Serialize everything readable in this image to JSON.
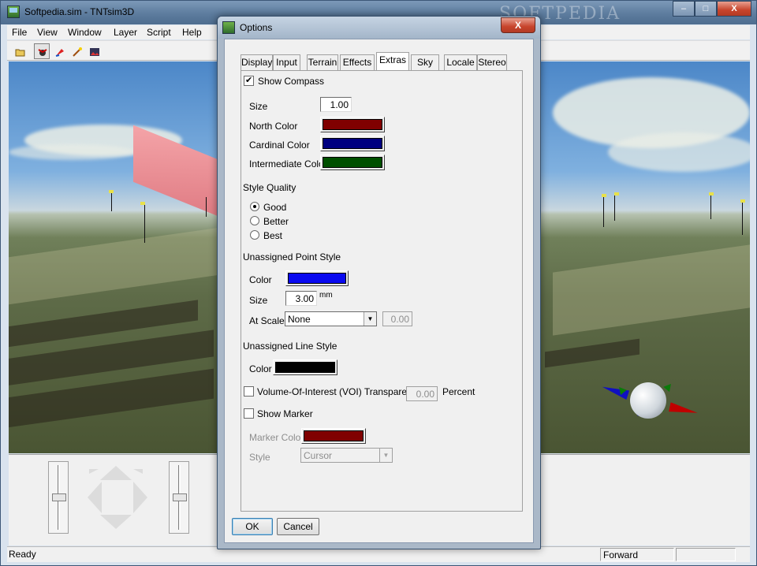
{
  "main_window": {
    "title": "Softpedia.sim - TNTsim3D",
    "watermark": "SOFTPEDIA",
    "controls": {
      "minimize": "–",
      "maximize": "□",
      "close": "X"
    },
    "menu": [
      "File",
      "View",
      "Window",
      "Layer",
      "Script",
      "Help"
    ],
    "toolbar_icons": [
      "open-folder-icon",
      "fly-mode-icon",
      "pointer-icon",
      "magic-wand-icon",
      "scene-icon"
    ]
  },
  "status": {
    "left": "Ready",
    "mode": "Forward"
  },
  "viewport": {
    "sky_color": "#7fb0df",
    "ground_color": "#5e6b48",
    "compass_colors": {
      "north": "#c00000",
      "cardinal": "#1010c0",
      "intermediate": "#0a7a0a"
    }
  },
  "dialog": {
    "title": "Options",
    "close_label": "X",
    "tabs": [
      "Display",
      "Input",
      "Terrain",
      "Effects",
      "Extras",
      "Sky",
      "Locale",
      "Stereo"
    ],
    "active_tab": "Extras",
    "show_compass": {
      "label": "Show Compass",
      "checked": true
    },
    "size": {
      "label": "Size",
      "value": "1.00"
    },
    "north_color": {
      "label": "North Color",
      "color": "#800000"
    },
    "cardinal_color": {
      "label": "Cardinal Color",
      "color": "#000080"
    },
    "intermediate_color": {
      "label": "Intermediate Color",
      "color": "#005000"
    },
    "style_quality": {
      "label": "Style Quality",
      "options": [
        "Good",
        "Better",
        "Best"
      ],
      "selected": "Good"
    },
    "point_style": {
      "label": "Unassigned Point Style",
      "color_label": "Color",
      "color": "#0a0af0",
      "size_label": "Size",
      "size_value": "3.00",
      "size_unit": "mm",
      "scale_label": "At Scale",
      "scale_value": "None",
      "scale_number": "0.00"
    },
    "line_style": {
      "label": "Unassigned Line Style",
      "color_label": "Color",
      "color": "#000000"
    },
    "voi": {
      "label": "Volume-Of-Interest (VOI) Transparency",
      "checked": false,
      "value": "0.00",
      "unit": "Percent"
    },
    "show_marker": {
      "label": "Show Marker",
      "checked": false
    },
    "marker_color": {
      "label": "Marker Color",
      "color": "#800000"
    },
    "marker_style": {
      "label": "Style",
      "value": "Cursor"
    },
    "ok_label": "OK",
    "cancel_label": "Cancel"
  }
}
